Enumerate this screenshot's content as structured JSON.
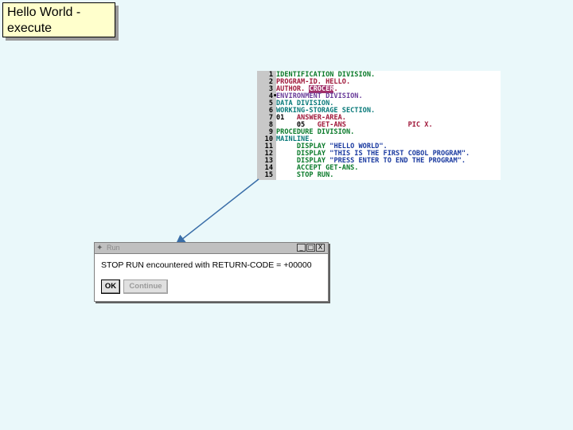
{
  "slide_title": "Hello World -\nexecute",
  "code": {
    "lines": [
      {
        "num": "1",
        "parts": [
          {
            "t": "IDENTIFICATION DIVISION.",
            "c": "kw-green"
          }
        ]
      },
      {
        "num": "2",
        "parts": [
          {
            "t": "PROGRAM-ID. HELLO.",
            "c": "kw-red"
          }
        ]
      },
      {
        "num": "3",
        "parts": [
          {
            "t": "AUTHOR. ",
            "c": "kw-red"
          },
          {
            "t": "CROCER",
            "c": "hl-crocer"
          },
          {
            "t": ".",
            "c": "kw-red"
          }
        ]
      },
      {
        "num": "4",
        "mark": "•",
        "parts": [
          {
            "t": "ENVIRONMENT DIVISION.",
            "c": "kw-purple"
          }
        ]
      },
      {
        "num": "5",
        "parts": [
          {
            "t": "DATA DIVISION.",
            "c": "kw-teal"
          }
        ]
      },
      {
        "num": "6",
        "parts": [
          {
            "t": "WORKING-STORAGE SECTION.",
            "c": "kw-teal"
          }
        ]
      },
      {
        "num": "7",
        "parts": [
          {
            "t": "01   ",
            "c": "kw-black"
          },
          {
            "t": "ANSWER-AREA.",
            "c": "kw-red"
          }
        ]
      },
      {
        "num": "8",
        "parts": [
          {
            "t": "     05   ",
            "c": "kw-black"
          },
          {
            "t": "GET-ANS",
            "c": "kw-red"
          },
          {
            "t": "               PIC X.",
            "c": "kw-red"
          }
        ]
      },
      {
        "num": "9",
        "parts": [
          {
            "t": "PROCEDURE DIVISION.",
            "c": "kw-green"
          }
        ]
      },
      {
        "num": "10",
        "parts": [
          {
            "t": "MAINLINE.",
            "c": "kw-teal"
          }
        ]
      },
      {
        "num": "11",
        "parts": [
          {
            "t": "     DISPLAY ",
            "c": "kw-green"
          },
          {
            "t": "\"HELLO WORLD\".",
            "c": "kw-blue"
          }
        ]
      },
      {
        "num": "12",
        "parts": [
          {
            "t": "     DISPLAY ",
            "c": "kw-green"
          },
          {
            "t": "\"THIS IS THE FIRST COBOL PROGRAM\".",
            "c": "kw-blue"
          }
        ]
      },
      {
        "num": "13",
        "parts": [
          {
            "t": "     DISPLAY ",
            "c": "kw-green"
          },
          {
            "t": "\"PRESS ENTER TO END THE PROGRAM\".",
            "c": "kw-blue"
          }
        ]
      },
      {
        "num": "14",
        "parts": [
          {
            "t": "     ACCEPT GET-ANS.",
            "c": "kw-green"
          }
        ]
      },
      {
        "num": "15",
        "parts": [
          {
            "t": "     STOP RUN.",
            "c": "kw-green"
          }
        ]
      }
    ]
  },
  "dialog": {
    "title": "Run",
    "minimize_glyph": "_",
    "maximize_glyph": "□",
    "close_glyph": "X",
    "message": "STOP RUN encountered with RETURN-CODE = +00000",
    "ok_label": "OK",
    "continue_label": "Continue"
  },
  "colors": {
    "background": "#eaf8fa",
    "title_box": "#ffffcc",
    "arrow": "#3a6ea8"
  }
}
